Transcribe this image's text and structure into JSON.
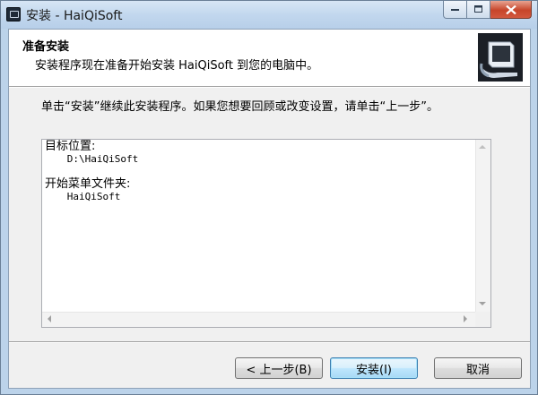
{
  "window": {
    "title": "安装 - HaiQiSoft",
    "controls": {
      "minimize": "minimize-icon",
      "maximize": "maximize-icon",
      "close": "close-icon"
    }
  },
  "header": {
    "title": "准备安装",
    "subtitle": "安装程序现在准备开始安装 HaiQiSoft 到您的电脑中。",
    "logo_icon": "setup-computer-icon"
  },
  "instruction": "单击“安装”继续此安装程序。如果您想要回顾或改变设置，请单击“上一步”。",
  "memo": {
    "dest_label": "目标位置:",
    "dest_value": "D:\\HaiQiSoft",
    "menu_label": "开始菜单文件夹:",
    "menu_value": "HaiQiSoft"
  },
  "buttons": {
    "back": "< 上一步(B)",
    "install": "安装(I)",
    "cancel": "取消"
  },
  "colors": {
    "titlebar": "#c2d7ee",
    "close_button": "#c7452a",
    "default_button_border": "#3c7fb1"
  }
}
